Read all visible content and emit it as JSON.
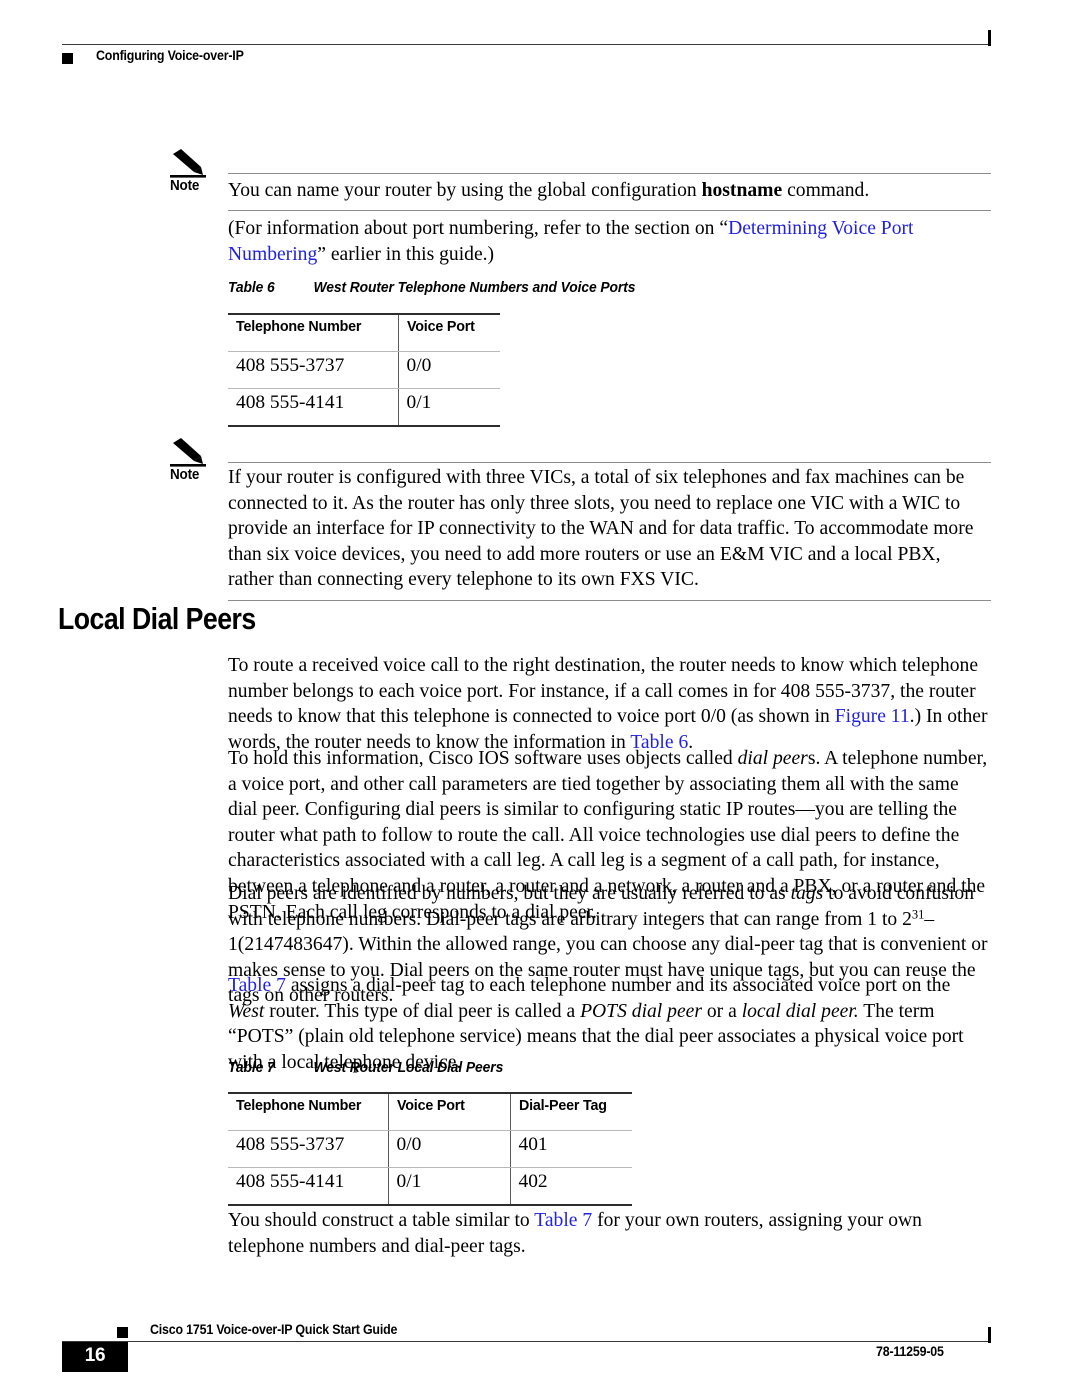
{
  "header": {
    "title": "Configuring Voice-over-IP",
    "bullet_icon": "black-square-icon"
  },
  "notes": [
    {
      "label": "Note",
      "icon": "pencil-icon",
      "text_before_bold": "You can name your router by using the global configuration ",
      "bold_term": "hostname",
      "text_after_bold": " command."
    },
    {
      "label": "Note",
      "icon": "pencil-icon",
      "text": "If your router is configured with three VICs, a total of six telephones and fax machines can be connected to it. As the router has only three slots, you need to replace one VIC with a WIC to provide an interface for IP connectivity to the WAN and for data traffic. To accommodate more than six voice devices, you need to add more routers or use an E&M VIC and a local PBX, rather than connecting every telephone to its own FXS VIC."
    }
  ],
  "port_numbering_paragraph": {
    "lead": "(For information about port numbering, refer to the section on “",
    "xref": "Determining Voice Port Numbering",
    "tail": "” earlier in this guide.)"
  },
  "table6": {
    "caption_number": "Table 6",
    "caption_title": "West Router Telephone Numbers and Voice Ports",
    "columns": [
      "Telephone Number",
      "Voice Port"
    ],
    "rows": [
      [
        "408 555-3737",
        "0/0"
      ],
      [
        "408 555-4141",
        "0/1"
      ]
    ]
  },
  "section": {
    "heading": "Local Dial Peers"
  },
  "paragraphs": {
    "p1": {
      "s1": "To route a received voice call to the right destination, the router needs to know which telephone number belongs to each voice port. For instance, if a call comes in for 408 555-3737, the router needs to know that this telephone is connected to voice port 0/0 (as shown in ",
      "xref1": "Figure 11",
      "s2": ".) In other words, the router needs to know the information in ",
      "xref2": "Table 6",
      "s3": "."
    },
    "p2": {
      "s1": "To hold this information, Cisco IOS software uses objects called ",
      "ital1": "dial peer",
      "s2": "s. A telephone number, a voice port, and other call parameters are tied together by associating them all with the same dial peer. Configuring dial peers is similar to configuring static IP routes—you are telling the router what path to follow to route the call. All voice technologies use dial peers to define the characteristics associated with a call leg. A call leg is a segment of a call path, for instance, between a telephone and a router, a router and a network, a router and a PBX, or a router and the PSTN. Each call leg corresponds to a dial peer."
    },
    "p3": {
      "s1": "Dial peers are identified by numbers, but they are usually referred to as ",
      "ital1": "tags",
      "s2": " to avoid confusion with telephone numbers. Dial-peer tags are arbitrary integers that can range from 1 to 2",
      "exp": "31",
      "s3": "–1(2147483647). Within the allowed range, you can choose any dial-peer tag that is convenient or makes sense to you. Dial peers on the same router must have unique tags, but you can reuse the tags on other routers."
    },
    "p4": {
      "xref1": "Table 7",
      "s1": " assigns a dial-peer tag to each telephone number and its associated voice port on the ",
      "ital1": "West",
      "s2": " router. This type of dial peer is called a ",
      "ital2": "POTS dial peer",
      "s3": " or a ",
      "ital3": "local dial peer.",
      "s4": " The term “POTS” (plain old telephone service) means that the dial peer associates a physical voice port with a local telephone device."
    },
    "p5": {
      "s1": "You should construct a table similar to ",
      "xref1": "Table 7",
      "s2": " for your own routers, assigning your own telephone numbers and dial-peer tags."
    }
  },
  "table7": {
    "caption_number": "Table 7",
    "caption_title": "West Router Local Dial Peers",
    "columns": [
      "Telephone Number",
      "Voice Port",
      "Dial-Peer Tag"
    ],
    "rows": [
      [
        "408 555-3737",
        "0/0",
        "401"
      ],
      [
        "408 555-4141",
        "0/1",
        "402"
      ]
    ]
  },
  "footer": {
    "guide_title": "Cisco 1751 Voice-over-IP Quick Start Guide",
    "page_number": "16",
    "doc_number": "78-11259-05",
    "bullet_icon": "black-square-icon"
  },
  "colors": {
    "xref": "#2222dd",
    "rule_dark": "#2d2d2d",
    "rule_light": "#b9b9b9",
    "note_rule": "#8d8d8d"
  }
}
